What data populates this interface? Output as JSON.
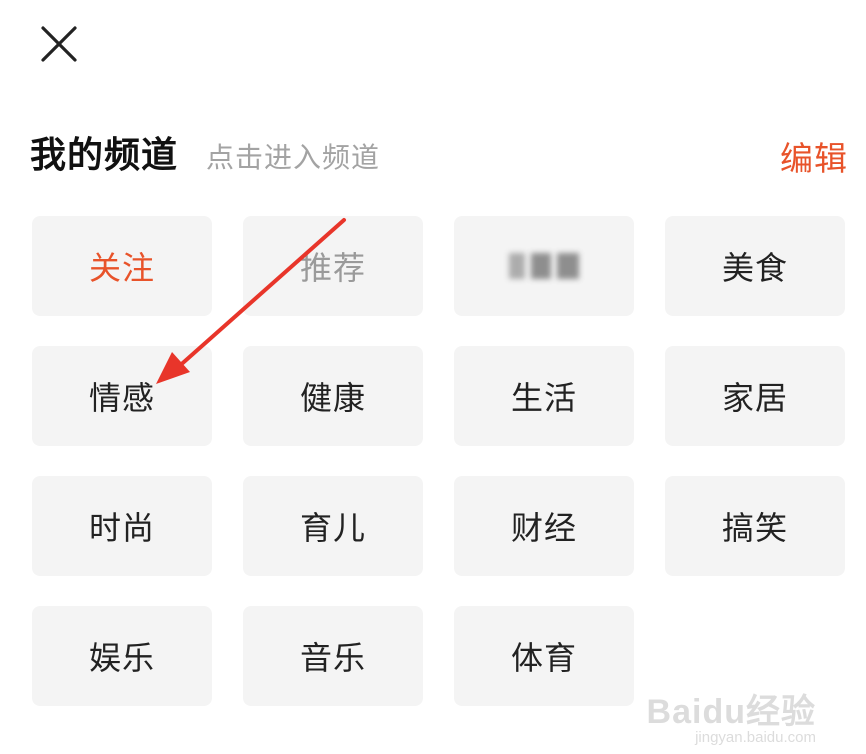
{
  "header": {
    "title": "我的频道",
    "subtitle": "点击进入频道",
    "edit_label": "编辑"
  },
  "channels": [
    {
      "label": "关注",
      "state": "active"
    },
    {
      "label": "推荐",
      "state": "fixed"
    },
    {
      "label": "",
      "state": "blurred"
    },
    {
      "label": "美食",
      "state": "normal"
    },
    {
      "label": "情感",
      "state": "normal"
    },
    {
      "label": "健康",
      "state": "normal"
    },
    {
      "label": "生活",
      "state": "normal"
    },
    {
      "label": "家居",
      "state": "normal"
    },
    {
      "label": "时尚",
      "state": "normal"
    },
    {
      "label": "育儿",
      "state": "normal"
    },
    {
      "label": "财经",
      "state": "normal"
    },
    {
      "label": "搞笑",
      "state": "normal"
    },
    {
      "label": "娱乐",
      "state": "normal"
    },
    {
      "label": "音乐",
      "state": "normal"
    },
    {
      "label": "体育",
      "state": "normal"
    }
  ],
  "colors": {
    "accent": "#e8532a",
    "tile_bg": "#f4f4f4",
    "subtitle": "#a3a3a3",
    "arrow": "#e8352a"
  },
  "watermark": {
    "main": "Baidu经验",
    "sub": "jingyan.baidu.com"
  }
}
